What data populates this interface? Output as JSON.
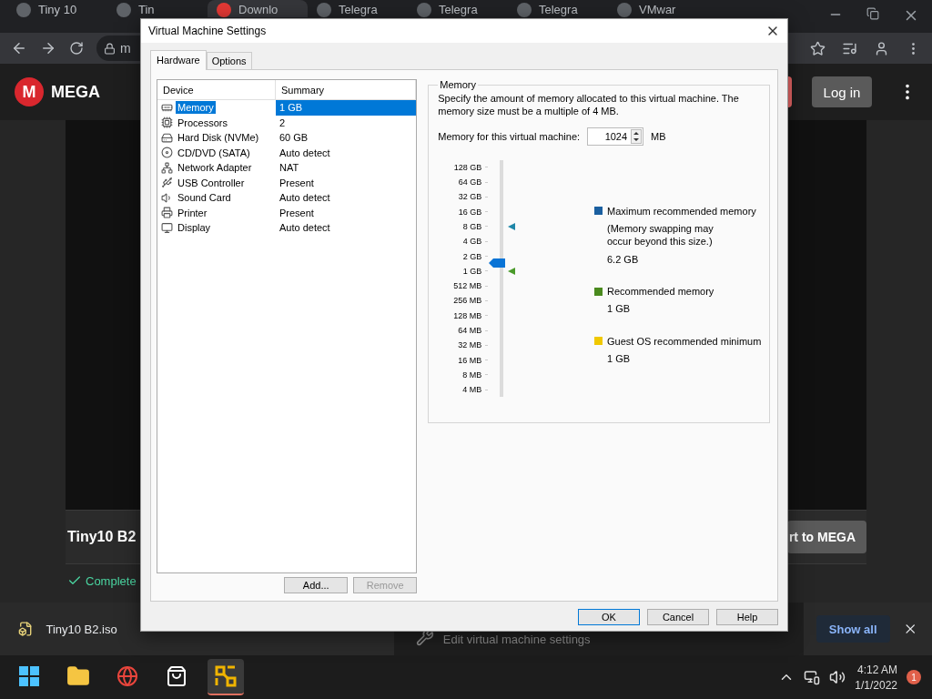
{
  "browser": {
    "tabs": [
      {
        "label": "Tiny 10",
        "selected": false
      },
      {
        "label": "Tin",
        "selected": false
      },
      {
        "label": "Downlo",
        "selected": true
      },
      {
        "label": "Telegra",
        "selected": false
      },
      {
        "label": "Telegra",
        "selected": false
      },
      {
        "label": "Telegra",
        "selected": false
      },
      {
        "label": "VMwar",
        "selected": false
      }
    ],
    "address": "m",
    "header": {
      "logo": "M",
      "brand": "MEGA",
      "login": "Log in"
    },
    "file": {
      "title": "Tiny10 B2",
      "action": "rt to MEGA",
      "status": "Complete"
    },
    "downloads": {
      "file": "Tiny10 B2.iso",
      "show_all": "Show all"
    },
    "background_window_text": "Edit virtual machine settings"
  },
  "dialog": {
    "title": "Virtual Machine Settings",
    "tabs": [
      {
        "label": "Hardware",
        "selected": true
      },
      {
        "label": "Options",
        "selected": false
      }
    ],
    "devices": {
      "columns": [
        "Device",
        "Summary"
      ],
      "rows": [
        {
          "kind": "memory",
          "device": "Memory",
          "summary": "1 GB",
          "selected": true
        },
        {
          "kind": "processor",
          "device": "Processors",
          "summary": "2",
          "selected": false
        },
        {
          "kind": "disk",
          "device": "Hard Disk (NVMe)",
          "summary": "60 GB",
          "selected": false
        },
        {
          "kind": "disc",
          "device": "CD/DVD (SATA)",
          "summary": "Auto detect",
          "selected": false
        },
        {
          "kind": "network",
          "device": "Network Adapter",
          "summary": "NAT",
          "selected": false
        },
        {
          "kind": "usb",
          "device": "USB Controller",
          "summary": "Present",
          "selected": false
        },
        {
          "kind": "sound",
          "device": "Sound Card",
          "summary": "Auto detect",
          "selected": false
        },
        {
          "kind": "printer",
          "device": "Printer",
          "summary": "Present",
          "selected": false
        },
        {
          "kind": "display",
          "device": "Display",
          "summary": "Auto detect",
          "selected": false
        }
      ]
    },
    "device_buttons": [
      {
        "label": "Add...",
        "disabled": false
      },
      {
        "label": "Remove",
        "disabled": true
      }
    ],
    "memory": {
      "group_title": "Memory",
      "description": "Specify the amount of memory allocated to this virtual machine. The memory size must be a multiple of 4 MB.",
      "field_label": "Memory for this virtual machine:",
      "value": "1024",
      "unit": "MB",
      "level": 0.571,
      "scale": [
        {
          "label": "128 GB"
        },
        {
          "label": "64 GB"
        },
        {
          "label": "32 GB"
        },
        {
          "label": "16 GB"
        },
        {
          "label": "8 GB",
          "kind": "maximum"
        },
        {
          "label": "4 GB"
        },
        {
          "label": "2 GB"
        },
        {
          "label": "1 GB",
          "kind": "recommended"
        },
        {
          "label": "512 MB"
        },
        {
          "label": "256 MB"
        },
        {
          "label": "128 MB"
        },
        {
          "label": "64 MB"
        },
        {
          "label": "32 MB"
        },
        {
          "label": "16 MB"
        },
        {
          "label": "8 MB"
        },
        {
          "label": "4 MB"
        }
      ],
      "legend": [
        {
          "label": "Maximum recommended memory",
          "note": "(Memory swapping may occur beyond this size.)",
          "value": "6.2 GB",
          "color": "#1a5fa0"
        },
        {
          "label": "Recommended memory",
          "value": "1 GB",
          "color": "#4a8a1e"
        },
        {
          "label": "Guest OS recommended minimum",
          "value": "1 GB",
          "color": "#f0c800"
        }
      ]
    },
    "buttons": [
      {
        "label": "OK",
        "selected": true
      },
      {
        "label": "Cancel",
        "selected": false
      },
      {
        "label": "Help",
        "selected": false
      }
    ]
  },
  "taskbar": {
    "apps": [
      {
        "kind": "start",
        "selected": false
      },
      {
        "kind": "files",
        "selected": false
      },
      {
        "kind": "chrome",
        "selected": false
      },
      {
        "kind": "store",
        "selected": false
      },
      {
        "kind": "vmware",
        "selected": true
      }
    ],
    "time": "4:12 AM",
    "date": "1/1/2022",
    "notifications": "1"
  }
}
